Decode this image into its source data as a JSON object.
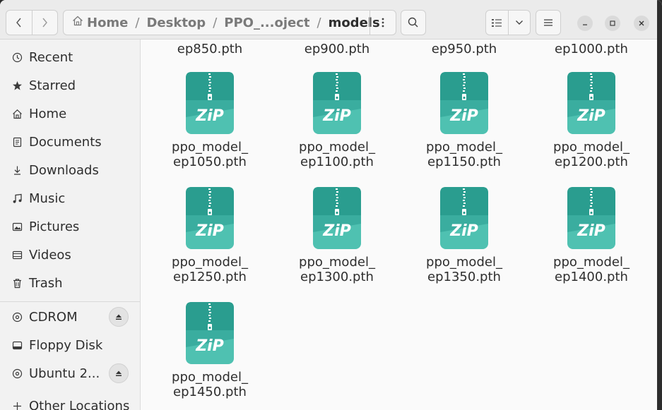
{
  "header": {
    "back_icon": "chevron-left-icon",
    "forward_icon": "chevron-right-icon",
    "breadcrumbs": [
      "Home",
      "Desktop",
      "PPO_...oject",
      "models"
    ],
    "path_menu_icon": "vertical-ellipsis-icon",
    "search_icon": "search-icon",
    "view_icon": "list-view-icon",
    "view_dropdown_icon": "chevron-down-icon",
    "menu_icon": "hamburger-menu-icon",
    "window_controls": [
      "minimize-icon",
      "maximize-icon",
      "close-icon"
    ]
  },
  "sidebar": {
    "places": [
      {
        "label": "Recent",
        "icon": "clock-icon"
      },
      {
        "label": "Starred",
        "icon": "star-icon"
      },
      {
        "label": "Home",
        "icon": "home-icon"
      },
      {
        "label": "Documents",
        "icon": "document-icon"
      },
      {
        "label": "Downloads",
        "icon": "download-icon"
      },
      {
        "label": "Music",
        "icon": "music-icon"
      },
      {
        "label": "Pictures",
        "icon": "picture-icon"
      },
      {
        "label": "Videos",
        "icon": "video-icon"
      },
      {
        "label": "Trash",
        "icon": "trash-icon"
      }
    ],
    "devices": [
      {
        "label": "CDROM",
        "icon": "disc-icon",
        "eject": true
      },
      {
        "label": "Floppy Disk",
        "icon": "drive-icon",
        "eject": false
      },
      {
        "label": "Ubuntu 2...",
        "icon": "disc-icon",
        "eject": true
      },
      {
        "label": "Other Locations",
        "icon": "plus-icon",
        "eject": false
      }
    ]
  },
  "files": {
    "partial_row": [
      "ep850.pth",
      "ep900.pth",
      "ep950.pth",
      "ep1000.pth"
    ],
    "items": [
      {
        "line1": "ppo_model_",
        "line2": "ep1050.pth"
      },
      {
        "line1": "ppo_model_",
        "line2": "ep1100.pth"
      },
      {
        "line1": "ppo_model_",
        "line2": "ep1150.pth"
      },
      {
        "line1": "ppo_model_",
        "line2": "ep1200.pth"
      },
      {
        "line1": "ppo_model_",
        "line2": "ep1250.pth"
      },
      {
        "line1": "ppo_model_",
        "line2": "ep1300.pth"
      },
      {
        "line1": "ppo_model_",
        "line2": "ep1350.pth"
      },
      {
        "line1": "ppo_model_",
        "line2": "ep1400.pth"
      },
      {
        "line1": "ppo_model_",
        "line2": "ep1450.pth"
      }
    ],
    "icon_text": "ZiP",
    "icon_name": "zip-archive-icon",
    "icon_color_top": "#2a9d8f",
    "icon_color_bottom": "#4fc1b1"
  }
}
